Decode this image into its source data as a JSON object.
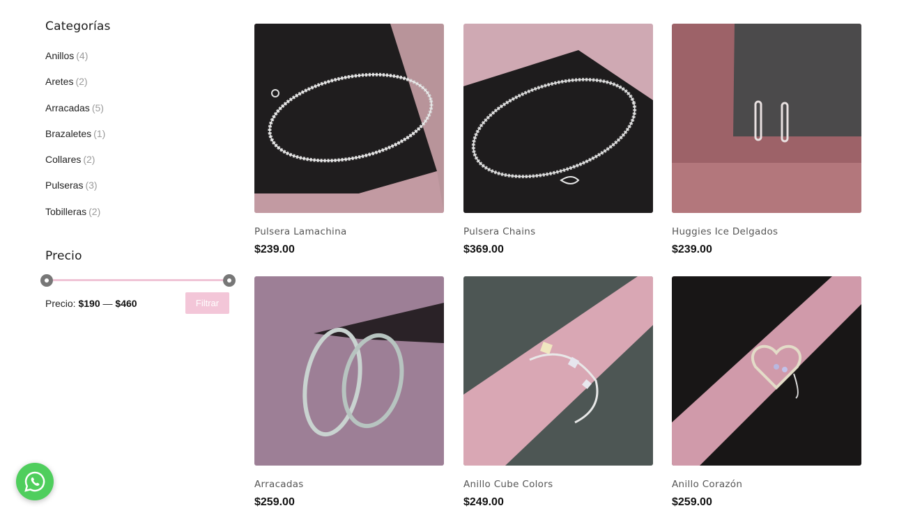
{
  "sidebar": {
    "categories_title": "Categorías",
    "categories": [
      {
        "label": "Anillos",
        "count": "(4)"
      },
      {
        "label": "Aretes",
        "count": "(2)"
      },
      {
        "label": "Arracadas",
        "count": "(5)"
      },
      {
        "label": "Brazaletes",
        "count": "(1)"
      },
      {
        "label": "Collares",
        "count": "(2)"
      },
      {
        "label": "Pulseras",
        "count": "(3)"
      },
      {
        "label": "Tobilleras",
        "count": "(2)"
      }
    ],
    "price_title": "Precio",
    "price_prefix": "Precio:",
    "price_min": "$190",
    "price_sep": "—",
    "price_max": "$460",
    "filter_label": "Filtrar"
  },
  "products": [
    {
      "name": "Pulsera Lamachina",
      "price": "$239.00",
      "image": "silver-bracelet-photo"
    },
    {
      "name": "Pulsera Chains",
      "price": "$369.00",
      "image": "silver-chain-bracelet-photo"
    },
    {
      "name": "Huggies Ice Delgados",
      "price": "$239.00",
      "image": "huggie-earrings-photo"
    },
    {
      "name": "Arracadas",
      "price": "$259.00",
      "image": "hoop-earrings-photo"
    },
    {
      "name": "Anillo Cube Colors",
      "price": "$249.00",
      "image": "cube-ring-photo"
    },
    {
      "name": "Anillo Corazón",
      "price": "$259.00",
      "image": "heart-ring-photo"
    }
  ],
  "colors": {
    "accent_pink": "#f3c6d8",
    "whatsapp_green": "#4fce5d"
  }
}
